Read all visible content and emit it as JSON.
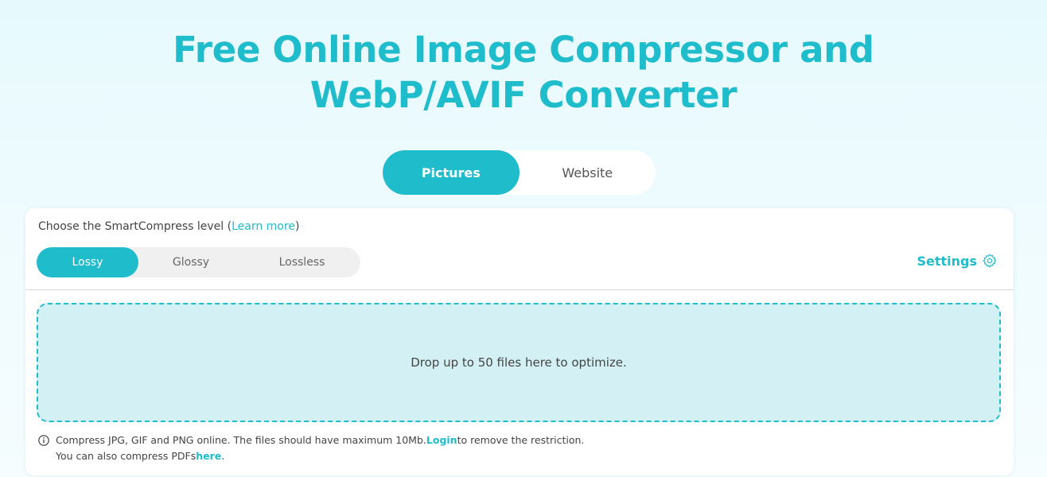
{
  "header": {
    "title_line1": "Free Online Image Compressor and",
    "title_line2": "WebP/AVIF Converter"
  },
  "mode_tabs": [
    {
      "label": "Pictures",
      "active": true
    },
    {
      "label": "Website",
      "active": false
    }
  ],
  "compress_level": {
    "label_prefix": "Choose the SmartCompress level (",
    "learn_more": "Learn more",
    "label_suffix": ")",
    "options": [
      {
        "label": "Lossy",
        "active": true
      },
      {
        "label": "Glossy",
        "active": false
      },
      {
        "label": "Lossless",
        "active": false
      }
    ]
  },
  "settings": {
    "label": "Settings",
    "icon": "gear-icon"
  },
  "dropzone": {
    "text": "Drop up to 50 files here to optimize."
  },
  "info": {
    "icon": "info-icon",
    "line1_text": "Compress JPG, GIF and PNG online. The files should have maximum 10Mb. ",
    "line1_link": "Login",
    "line1_suffix": " to remove the restriction.",
    "line2_text": "You can also compress PDFs ",
    "line2_link": "here",
    "line2_suffix": "."
  },
  "colors": {
    "accent": "#1fbccb",
    "dropzone_bg": "#d3f1f4",
    "toggle_bg": "#f0f0f0"
  }
}
